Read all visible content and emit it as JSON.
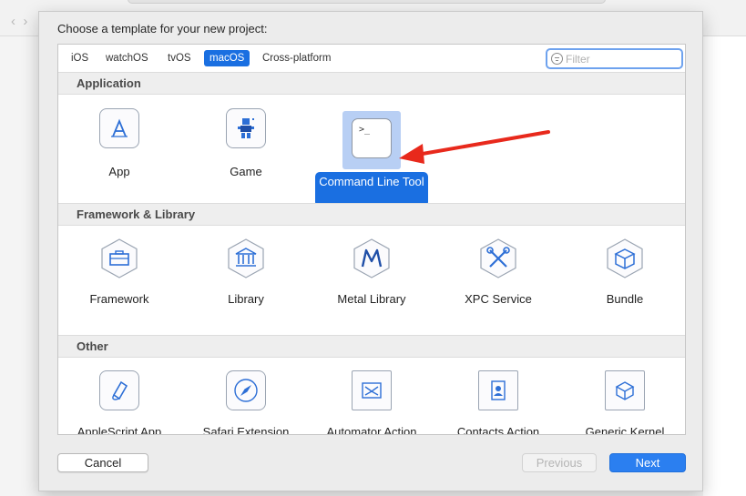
{
  "sheet": {
    "title": "Choose a template for your new project:"
  },
  "tabs": [
    {
      "label": "iOS",
      "active": false
    },
    {
      "label": "watchOS",
      "active": false
    },
    {
      "label": "tvOS",
      "active": false
    },
    {
      "label": "macOS",
      "active": true
    },
    {
      "label": "Cross-platform",
      "active": false
    }
  ],
  "filter": {
    "placeholder": "Filter",
    "value": ""
  },
  "sections": [
    {
      "title": "Application",
      "items": [
        {
          "label": "App",
          "icon": "app-store-a-icon"
        },
        {
          "label": "Game",
          "icon": "game-sprite-icon"
        },
        {
          "label": "Command Line Tool",
          "icon": "terminal-icon",
          "selected": true
        }
      ]
    },
    {
      "title": "Framework & Library",
      "items": [
        {
          "label": "Framework",
          "icon": "toolbox-icon"
        },
        {
          "label": "Library",
          "icon": "library-building-icon"
        },
        {
          "label": "Metal Library",
          "icon": "metal-icon"
        },
        {
          "label": "XPC Service",
          "icon": "wrench-screwdriver-icon"
        },
        {
          "label": "Bundle",
          "icon": "package-cube-icon"
        }
      ]
    },
    {
      "title": "Other",
      "items": [
        {
          "label": "AppleScript App",
          "icon": "applescript-scroll-icon"
        },
        {
          "label": "Safari Extension",
          "icon": "compass-icon"
        },
        {
          "label": "Automator Action",
          "icon": "automator-icon"
        },
        {
          "label": "Contacts Action",
          "icon": "contacts-icon"
        },
        {
          "label": "Generic Kernel",
          "icon": "kernel-cube-icon"
        }
      ]
    }
  ],
  "buttons": {
    "cancel": "Cancel",
    "previous": "Previous",
    "next": "Next"
  },
  "colors": {
    "accent": "#1a6fe1",
    "selection_tint": "#b8cff4",
    "annotation_arrow": "#e8291c"
  }
}
